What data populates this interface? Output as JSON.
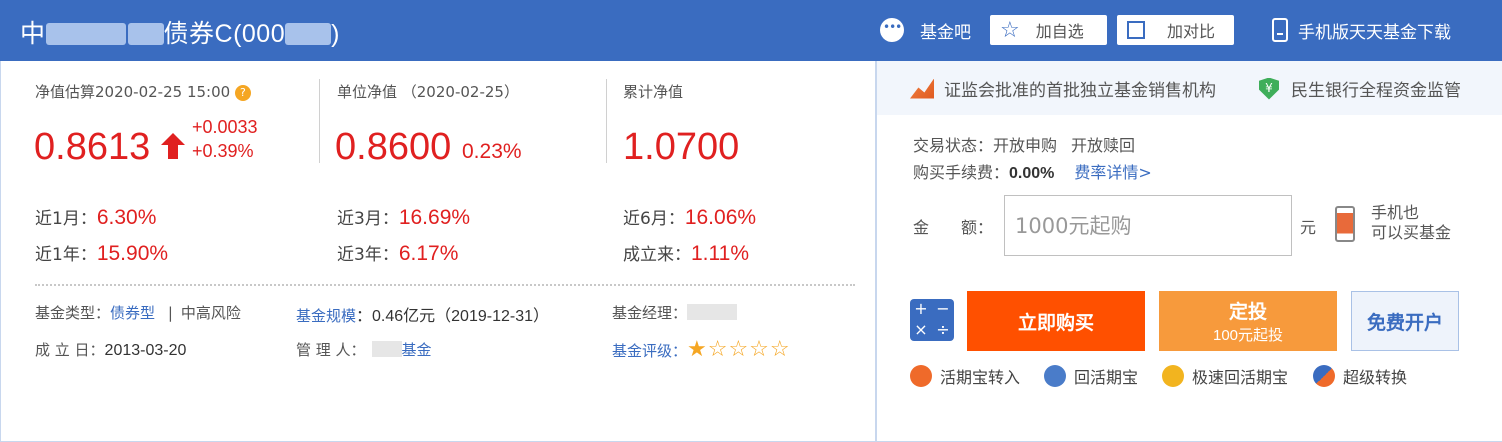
{
  "header": {
    "title_prefix": "中",
    "title_mid": "债券C(000",
    "title_suffix": ")",
    "forum": "基金吧",
    "add_watch": "加自选",
    "add_compare": "加对比",
    "mobile_download": "手机版天天基金下载"
  },
  "nav_estimate": {
    "label": "净值估算2020-02-25 15:00",
    "value": "0.8613",
    "change_abs": "+0.0033",
    "change_pct": "+0.39%"
  },
  "unit_nav": {
    "label": "单位净值 （2020-02-25）",
    "value": "0.8600",
    "change_pct": "0.23%"
  },
  "cum_nav": {
    "label": "累计净值",
    "value": "1.0700"
  },
  "performance": [
    {
      "label": "近1月：",
      "value": "6.30%"
    },
    {
      "label": "近3月：",
      "value": "16.69%"
    },
    {
      "label": "近6月：",
      "value": "16.06%"
    },
    {
      "label": "近1年：",
      "value": "15.90%"
    },
    {
      "label": "近3年：",
      "value": "6.17%"
    },
    {
      "label": "成立来：",
      "value": "1.11%"
    }
  ],
  "info": {
    "type_label": "基金类型：",
    "type_value": "债券型",
    "sep": "|",
    "risk": "中高风险",
    "scale_label": "基金规模",
    "scale_value": "：0.46亿元（2019-12-31）",
    "manager_label": "基金经理：",
    "inception_label": "成 立 日：",
    "inception_value": "2013-03-20",
    "custodian_label": "管 理 人：",
    "custodian_value": "基金",
    "rating_label": "基金评级：",
    "rating_stars": 1,
    "rating_max": 5
  },
  "promo": {
    "item1": "证监会批准的首批独立基金销售机构",
    "item2": "民生银行全程资金监管"
  },
  "trade": {
    "status_label": "交易状态：",
    "status1": "开放申购",
    "status2": "开放赎回",
    "fee_label": "购买手续费：",
    "fee_value": "0.00%",
    "fee_detail": "费率详情>",
    "amount_label": "金　　额：",
    "amount_placeholder": "1000元起购",
    "unit": "元",
    "mobile_line1": "手机也",
    "mobile_line2": "可以买基金"
  },
  "buttons": {
    "buy": "立即购买",
    "auto_title": "定投",
    "auto_sub": "100元起投",
    "open": "免费开户"
  },
  "links": [
    "活期宝转入",
    "回活期宝",
    "极速回活期宝",
    "超级转换"
  ],
  "colors": {
    "header_bg": "#3a6cc0",
    "red": "#e02020",
    "buy": "#ff5000",
    "auto": "#f79a3c",
    "star": "#f5a623"
  }
}
